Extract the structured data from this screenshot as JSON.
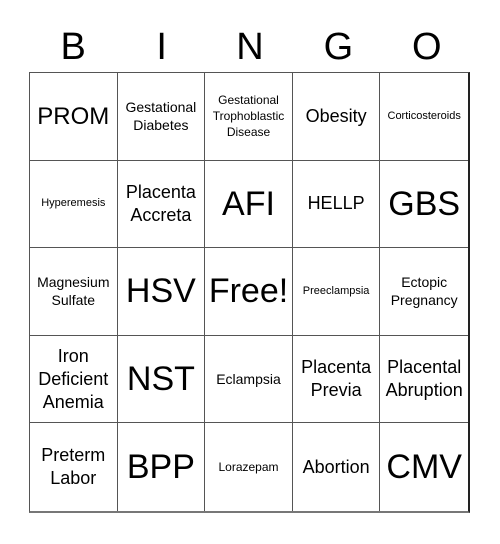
{
  "header": {
    "letters": [
      "B",
      "I",
      "N",
      "G",
      "O"
    ]
  },
  "cells": [
    {
      "text": "PROM",
      "size": "s-lg"
    },
    {
      "text": "Gestational Diabetes",
      "size": "s-sm"
    },
    {
      "text": "Gestational Trophoblastic Disease",
      "size": "s-xs"
    },
    {
      "text": "Obesity",
      "size": "s-md"
    },
    {
      "text": "Corticosteroids",
      "size": "s-xxs"
    },
    {
      "text": "Hyperemesis",
      "size": "s-xxs"
    },
    {
      "text": "Placenta Accreta",
      "size": "s-md"
    },
    {
      "text": "AFI",
      "size": "s-xl"
    },
    {
      "text": "HELLP",
      "size": "s-md"
    },
    {
      "text": "GBS",
      "size": "s-xl"
    },
    {
      "text": "Magnesium Sulfate",
      "size": "s-sm"
    },
    {
      "text": "HSV",
      "size": "s-xl"
    },
    {
      "text": "Free!",
      "size": "s-xl"
    },
    {
      "text": "Preeclampsia",
      "size": "s-xxs"
    },
    {
      "text": "Ectopic Pregnancy",
      "size": "s-sm"
    },
    {
      "text": "Iron Deficient Anemia",
      "size": "s-md"
    },
    {
      "text": "NST",
      "size": "s-xl"
    },
    {
      "text": "Eclampsia",
      "size": "s-sm"
    },
    {
      "text": "Placenta Previa",
      "size": "s-md"
    },
    {
      "text": "Placental Abruption",
      "size": "s-md"
    },
    {
      "text": "Preterm Labor",
      "size": "s-md"
    },
    {
      "text": "BPP",
      "size": "s-xl"
    },
    {
      "text": "Lorazepam",
      "size": "s-xs"
    },
    {
      "text": "Abortion",
      "size": "s-md"
    },
    {
      "text": "CMV",
      "size": "s-xl"
    }
  ]
}
